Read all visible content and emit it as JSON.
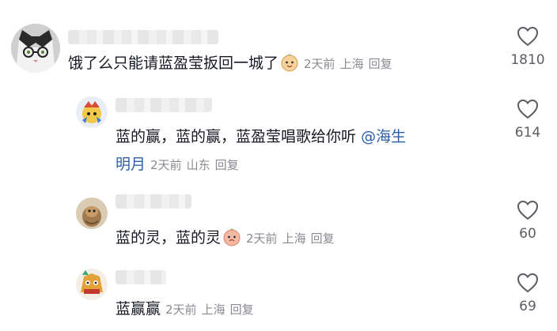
{
  "comments": [
    {
      "text": "饿了么只能请蓝盈莹扳回一城了",
      "emoji": "peach-face-emoji",
      "time": "2天前",
      "location": "上海",
      "reply_label": "回复",
      "likes": "1810"
    },
    {
      "text_line1": "蓝的赢，蓝的赢，蓝盈莹唱歌给你听",
      "mention_part1": "@海生",
      "mention_part2": "明月",
      "time": "2天前",
      "location": "山东",
      "reply_label": "回复",
      "likes": "614"
    },
    {
      "text": "蓝的灵，蓝的灵",
      "emoji": "peach-face-emoji",
      "time": "2天前",
      "location": "上海",
      "reply_label": "回复",
      "likes": "60"
    },
    {
      "text": "蓝赢赢",
      "time": "2天前",
      "location": "上海",
      "reply_label": "回复",
      "likes": "69"
    }
  ],
  "colors": {
    "text": "#161823",
    "meta": "#8a8b91",
    "mention": "#2c5fa8",
    "heart_stroke": "#5c5d63"
  }
}
